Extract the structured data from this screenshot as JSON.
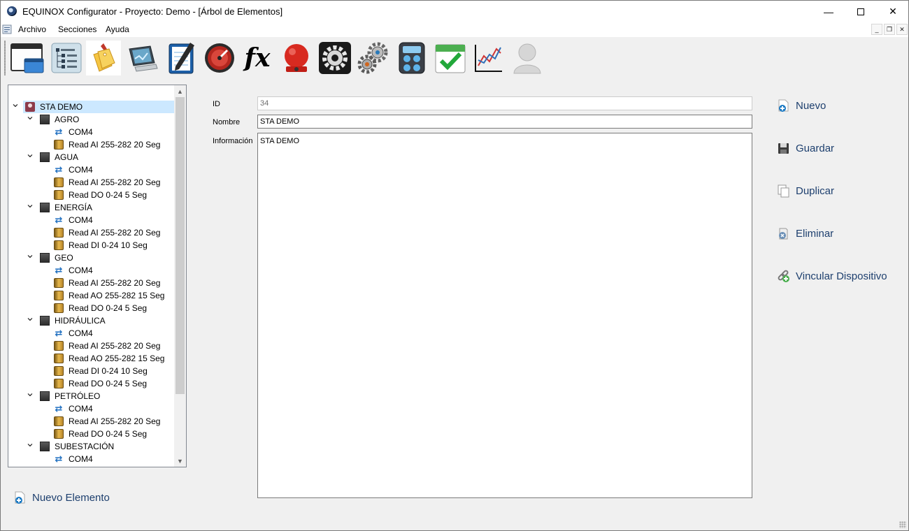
{
  "window": {
    "title": "EQUINOX Configurator - Proyecto: Demo - [Árbol de Elementos]"
  },
  "menu": {
    "items": [
      "Archivo",
      "Secciones",
      "Ayuda"
    ]
  },
  "toolbar": {
    "icons": [
      "window-icon",
      "tree-structure-icon",
      "tags-icon",
      "monitor-icon",
      "notepad-icon",
      "gauge-icon",
      "function-fx-icon",
      "alarm-bell-icon",
      "settings-gear-icon",
      "gears-icon",
      "calculator-icon",
      "calendar-check-icon",
      "line-chart-icon",
      "user-icon"
    ],
    "fx_label": "fx"
  },
  "tree": {
    "nodes": [
      {
        "label": "STA DEMO",
        "level": 0,
        "icon": "location",
        "expanded": true,
        "selected": true
      },
      {
        "label": "AGRO",
        "level": 1,
        "icon": "box",
        "expanded": true
      },
      {
        "label": "COM4",
        "level": 2,
        "icon": "com"
      },
      {
        "label": "Read AI 255-282 20 Seg",
        "level": 2,
        "icon": "read"
      },
      {
        "label": "AGUA",
        "level": 1,
        "icon": "box",
        "expanded": true
      },
      {
        "label": "COM4",
        "level": 2,
        "icon": "com"
      },
      {
        "label": "Read AI 255-282 20 Seg",
        "level": 2,
        "icon": "read"
      },
      {
        "label": "Read DO 0-24 5 Seg",
        "level": 2,
        "icon": "read"
      },
      {
        "label": "ENERGÍA",
        "level": 1,
        "icon": "box",
        "expanded": true
      },
      {
        "label": "COM4",
        "level": 2,
        "icon": "com"
      },
      {
        "label": "Read AI 255-282 20 Seg",
        "level": 2,
        "icon": "read"
      },
      {
        "label": "Read DI 0-24 10 Seg",
        "level": 2,
        "icon": "read"
      },
      {
        "label": "GEO",
        "level": 1,
        "icon": "box",
        "expanded": true
      },
      {
        "label": "COM4",
        "level": 2,
        "icon": "com"
      },
      {
        "label": "Read AI 255-282 20 Seg",
        "level": 2,
        "icon": "read"
      },
      {
        "label": "Read AO 255-282 15 Seg",
        "level": 2,
        "icon": "read"
      },
      {
        "label": "Read DO 0-24 5 Seg",
        "level": 2,
        "icon": "read"
      },
      {
        "label": "HIDRÁULICA",
        "level": 1,
        "icon": "box",
        "expanded": true
      },
      {
        "label": "COM4",
        "level": 2,
        "icon": "com"
      },
      {
        "label": "Read AI 255-282 20 Seg",
        "level": 2,
        "icon": "read"
      },
      {
        "label": "Read AO 255-282 15 Seg",
        "level": 2,
        "icon": "read"
      },
      {
        "label": "Read DI 0-24 10 Seg",
        "level": 2,
        "icon": "read"
      },
      {
        "label": "Read DO 0-24 5 Seg",
        "level": 2,
        "icon": "read"
      },
      {
        "label": "PETRÓLEO",
        "level": 1,
        "icon": "box",
        "expanded": true
      },
      {
        "label": "COM4",
        "level": 2,
        "icon": "com"
      },
      {
        "label": "Read AI 255-282 20 Seg",
        "level": 2,
        "icon": "read"
      },
      {
        "label": "Read DO 0-24 5 Seg",
        "level": 2,
        "icon": "read"
      },
      {
        "label": "SUBESTACIÓN",
        "level": 1,
        "icon": "box",
        "expanded": true
      },
      {
        "label": "COM4",
        "level": 2,
        "icon": "com"
      }
    ]
  },
  "form": {
    "id_label": "ID",
    "id_value": "34",
    "nombre_label": "Nombre",
    "nombre_value": "STA DEMO",
    "info_label": "Información",
    "info_value": "STA DEMO"
  },
  "actions": {
    "nuevo": "Nuevo",
    "guardar": "Guardar",
    "duplicar": "Duplicar",
    "eliminar": "Eliminar",
    "vincular": "Vincular Dispositivo"
  },
  "bottom": {
    "nuevo_elemento": "Nuevo Elemento"
  },
  "colors": {
    "selection": "#cce8ff",
    "action_text": "#1d3f6e",
    "location_icon": "#8c3a4b"
  }
}
